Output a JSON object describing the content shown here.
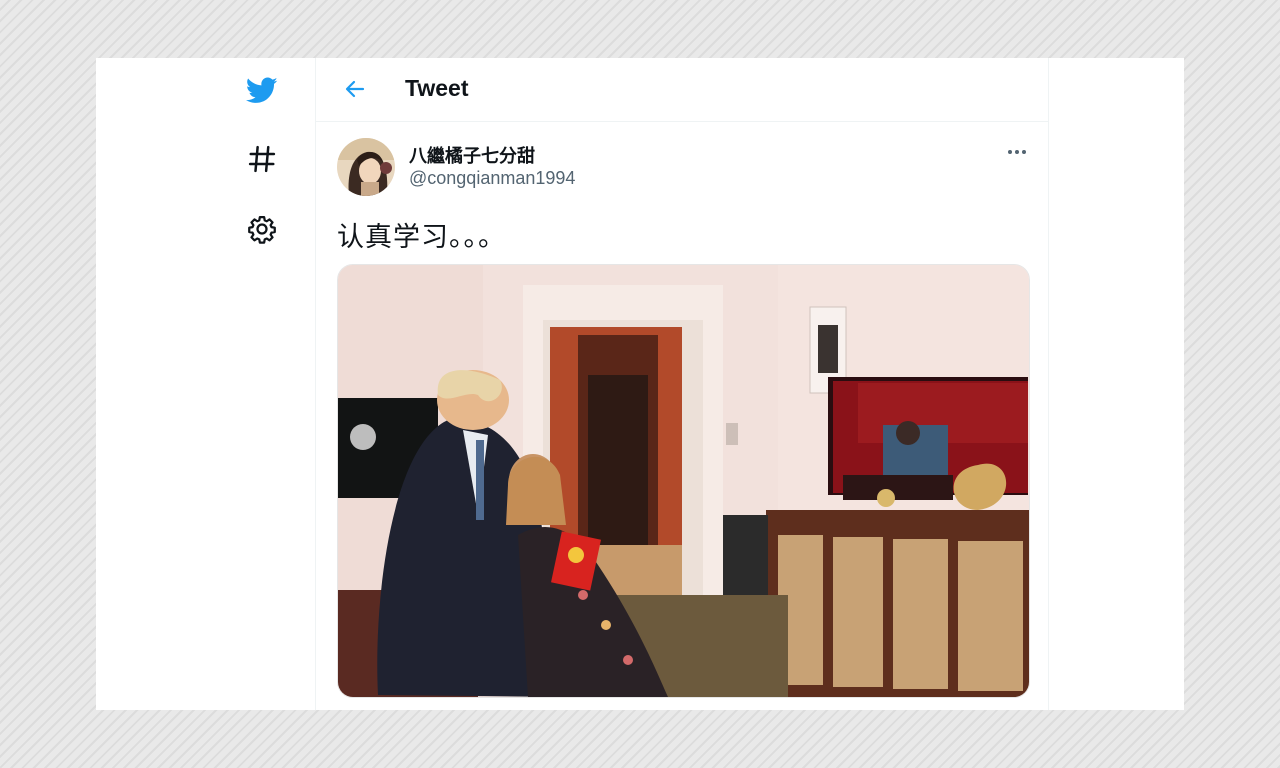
{
  "sidebar": {
    "logo": {
      "icon": "twitter-bird-icon",
      "color": "#1d9bf0"
    },
    "items": [
      {
        "icon": "hashtag-icon",
        "label": "Explore"
      },
      {
        "icon": "gear-icon",
        "label": "Settings"
      }
    ]
  },
  "header": {
    "back_icon": "arrow-left-icon",
    "title": "Tweet"
  },
  "tweet": {
    "author": {
      "display_name": "八繼橘子七分甜",
      "handle": "@congqianman1994"
    },
    "more_icon": "more-dots-icon",
    "text": "认真学习。。。",
    "media": {
      "type": "photo"
    }
  },
  "colors": {
    "accent": "#1d9bf0",
    "text_primary": "#0f1419",
    "text_secondary": "#536471",
    "divider": "#eff3f4"
  }
}
